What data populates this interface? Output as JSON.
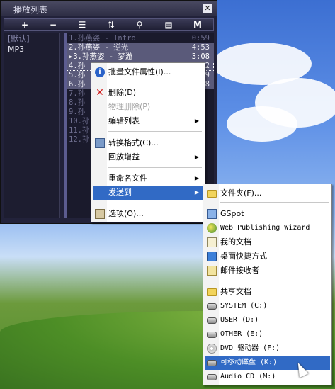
{
  "window": {
    "title": "播放列表",
    "close": "✕",
    "toolbar": [
      "+",
      "−",
      "☰",
      "⇅",
      "⚲",
      "▤",
      "M"
    ]
  },
  "categories": [
    {
      "label": "[默认]",
      "selected": false
    },
    {
      "label": "MP3",
      "selected": true
    }
  ],
  "tracks": [
    {
      "name": "1.孙燕姿 - Intro",
      "duration": "0:59"
    },
    {
      "name": "2.孙燕姿 - 逆光",
      "duration": "4:53"
    },
    {
      "name": "▸3.孙燕姿 - 梦游",
      "duration": "3:08"
    },
    {
      "name": "4.孙",
      "duration": "2"
    },
    {
      "name": "5.孙",
      "duration": "9"
    },
    {
      "name": "6.孙",
      "duration": "8"
    },
    {
      "name": "7.孙",
      "duration": ""
    },
    {
      "name": "8.孙",
      "duration": ""
    },
    {
      "name": "9.孙",
      "duration": ""
    },
    {
      "name": "10.孙",
      "duration": ""
    },
    {
      "name": "11.孙",
      "duration": ""
    },
    {
      "name": "12.孙",
      "duration": ""
    }
  ],
  "context_menu": [
    {
      "label": "批量文件属性(I)...",
      "icon": "info-icon"
    },
    {
      "label": "删除(D)",
      "icon": "delete-icon"
    },
    {
      "label": "物理删除(P)",
      "disabled": true
    },
    {
      "label": "编辑列表",
      "submenu": true
    },
    {
      "label": "转换格式(C)...",
      "icon": "convert-icon"
    },
    {
      "label": "回放增益",
      "submenu": true
    },
    {
      "label": "重命名文件",
      "submenu": true
    },
    {
      "label": "发送到",
      "submenu": true,
      "highlighted": true
    },
    {
      "label": "选项(O)...",
      "icon": "options-icon"
    }
  ],
  "send_to_menu": [
    {
      "label": "文件夹(F)...",
      "icon": "folder-icon"
    },
    {
      "label": "GSpot",
      "icon": "gspot-icon"
    },
    {
      "label": "Web Publishing Wizard",
      "icon": "globe-icon"
    },
    {
      "label": "我的文档",
      "icon": "documents-icon"
    },
    {
      "label": "桌面快捷方式",
      "icon": "desktop-icon"
    },
    {
      "label": "邮件接收者",
      "icon": "mail-icon"
    },
    {
      "label": "共享文档",
      "icon": "folder-icon"
    },
    {
      "label": "SYSTEM (C:)",
      "icon": "drive-icon"
    },
    {
      "label": "USER (D:)",
      "icon": "drive-icon"
    },
    {
      "label": "OTHER (E:)",
      "icon": "drive-icon"
    },
    {
      "label": "DVD 驱动器 (F:)",
      "icon": "dvd-icon"
    },
    {
      "label": "可移动磁盘 (K:)",
      "icon": "removable-drive-icon",
      "highlighted": true
    },
    {
      "label": "Audio CD (M:)",
      "icon": "drive-icon"
    }
  ],
  "colors": {
    "menu_highlight": "#316ac5",
    "window_bg": "#22223a"
  }
}
